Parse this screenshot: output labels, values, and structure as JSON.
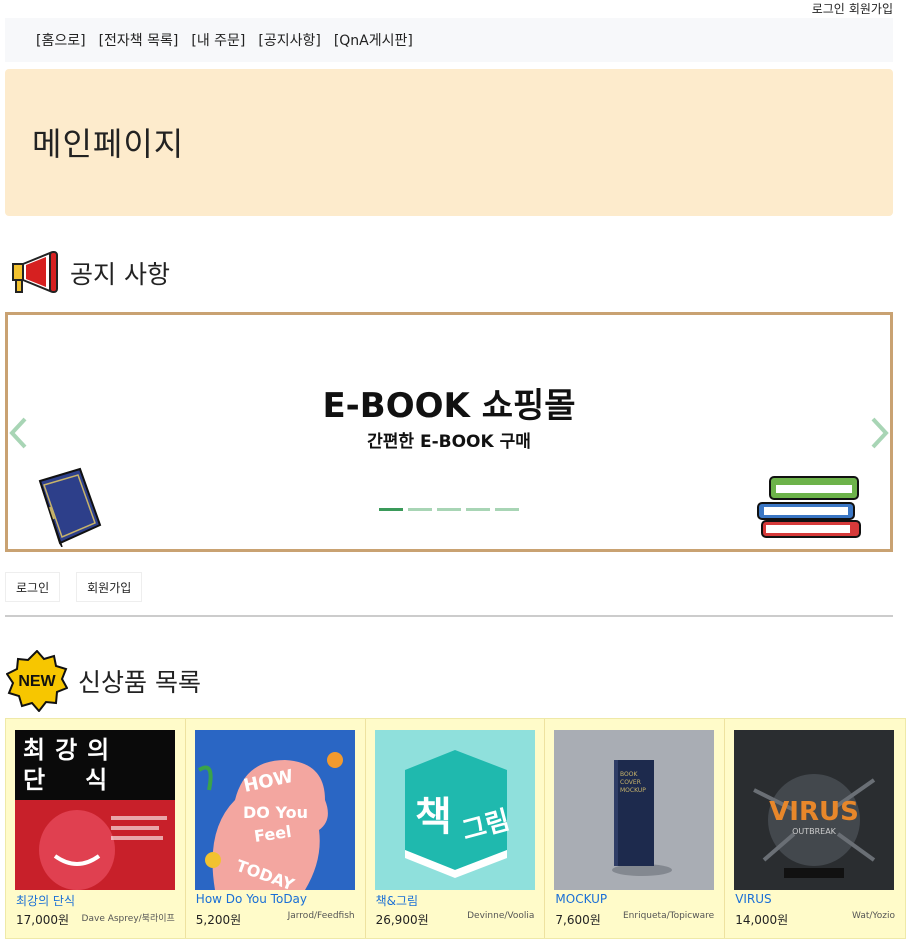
{
  "top_links": {
    "login": "로그인",
    "signup": "회원가입"
  },
  "nav": [
    "[홈으로]",
    "[전자책 목록]",
    "[내 주문]",
    "[공지사항]",
    "[QnA게시판]"
  ],
  "hero": {
    "title": "메인페이지"
  },
  "notice": {
    "heading": "공지 사항",
    "carousel": {
      "title": "E-BOOK 쇼핑몰",
      "subtitle": "간편한 E-BOOK 구매",
      "slide_count": 5,
      "active_index": 0
    }
  },
  "auth_buttons": {
    "login": "로그인",
    "signup": "회원가입"
  },
  "new_products": {
    "badge": "NEW",
    "heading": "신상품 목록",
    "items": [
      {
        "name": "최강의 단식",
        "price": "17,000원",
        "author": "Dave Asprey/북라이프",
        "cover_text": "최 강 의 단 식"
      },
      {
        "name": "How Do You ToDay",
        "price": "5,200원",
        "author": "Jarrod/Feedfish",
        "cover_text": "HOW DO You Feel TODAY"
      },
      {
        "name": "책&그림",
        "price": "26,900원",
        "author": "Devinne/Voolia",
        "cover_text": "책 그림"
      },
      {
        "name": "MOCKUP",
        "price": "7,600원",
        "author": "Enriqueta/Topicware",
        "cover_text": "BOOK COVER MOCKUP"
      },
      {
        "name": "VIRUS",
        "price": "14,000원",
        "author": "Wat/Yozio",
        "cover_text": "VIRUS"
      }
    ]
  },
  "colors": {
    "hero_bg": "#fdebcc",
    "carousel_border": "#c9a272",
    "products_bg": "#fffbc9",
    "link": "#1a6fd6",
    "indicator_active": "#3a9a5a"
  }
}
